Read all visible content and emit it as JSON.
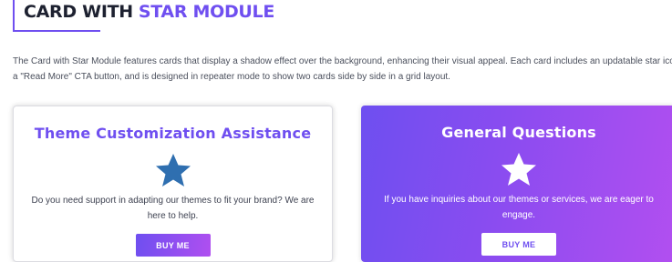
{
  "header": {
    "title_part1": "CARD WITH",
    "title_part2": "STAR MODULE"
  },
  "description": "The Card with Star Module features cards that display a shadow effect over the background, enhancing their visual appeal. Each card includes an updatable star icon, a \"Read More\" CTA button, and is designed in repeater mode to show two cards side by side in a grid layout.",
  "cards": [
    {
      "title": "Theme Customization Assistance",
      "icon": "star-icon",
      "icon_color": "#2f6fb0",
      "text": "Do you need support in adapting our themes to fit your brand? We are here to help.",
      "button_label": "BUY ME"
    },
    {
      "title": "General Questions",
      "icon": "star-icon",
      "icon_color": "#ffffff",
      "text": "If you have inquiries about our themes or services, we are eager to engage.",
      "button_label": "BUY ME"
    }
  ],
  "colors": {
    "accent": "#6f4ff0",
    "heading_dark": "#1d2130",
    "gradient_start": "#6e4ff0",
    "gradient_end": "#b24ff0"
  }
}
